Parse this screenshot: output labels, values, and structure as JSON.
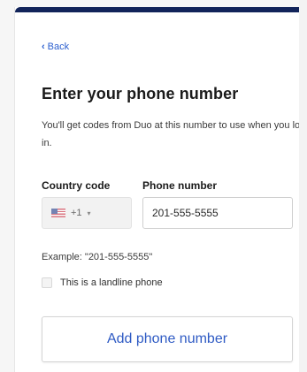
{
  "nav": {
    "back_label": "Back"
  },
  "page": {
    "title": "Enter your phone number",
    "description": "You'll get codes from Duo at this number to use when you log in."
  },
  "form": {
    "country_code": {
      "label": "Country code",
      "selected_value": "+1",
      "flag_icon": "us-flag-icon"
    },
    "phone_number": {
      "label": "Phone number",
      "value": "201-555-5555"
    },
    "example_text": "Example: \"201-555-5555\"",
    "landline": {
      "label": "This is a landline phone",
      "checked": false
    },
    "submit_label": "Add phone number"
  },
  "colors": {
    "accent": "#2f5bc4",
    "topbar": "#12245a",
    "link": "#2b5fcf"
  }
}
